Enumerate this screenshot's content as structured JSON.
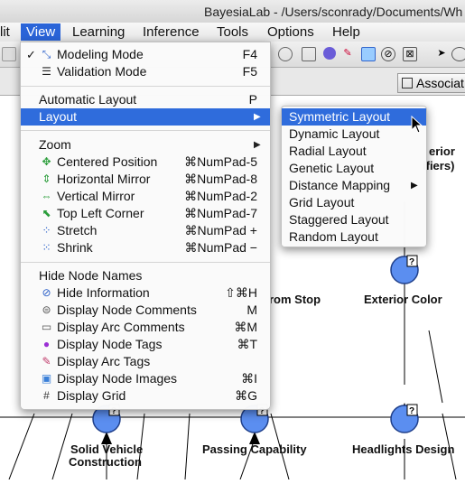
{
  "app": {
    "title": "BayesiaLab - /Users/sconrady/Documents/Wh"
  },
  "menubar": {
    "items": [
      "lit",
      "View",
      "Learning",
      "Inference",
      "Tools",
      "Options",
      "Help"
    ]
  },
  "tabstrip": {
    "assoc_tab": "Associat"
  },
  "view_menu": {
    "modeling_mode": {
      "label": "Modeling Mode",
      "shortcut": "F4",
      "checked": true
    },
    "validation_mode": {
      "label": "Validation Mode",
      "shortcut": "F5"
    },
    "automatic_layout": {
      "label": "Automatic Layout",
      "shortcut": "P"
    },
    "layout": {
      "label": "Layout"
    },
    "zoom": {
      "label": "Zoom"
    },
    "centered_position": {
      "label": "Centered Position",
      "shortcut": "⌘NumPad-5"
    },
    "horizontal_mirror": {
      "label": "Horizontal Mirror",
      "shortcut": "⌘NumPad-8"
    },
    "vertical_mirror": {
      "label": "Vertical Mirror",
      "shortcut": "⌘NumPad-2"
    },
    "top_left_corner": {
      "label": "Top Left Corner",
      "shortcut": "⌘NumPad-7"
    },
    "stretch": {
      "label": "Stretch",
      "shortcut": "⌘NumPad +"
    },
    "shrink": {
      "label": "Shrink",
      "shortcut": "⌘NumPad −"
    },
    "hide_node_names": {
      "label": "Hide Node Names"
    },
    "hide_information": {
      "label": "Hide Information",
      "shortcut": "⇧⌘H"
    },
    "display_node_comments": {
      "label": "Display Node Comments",
      "shortcut": "M"
    },
    "display_arc_comments": {
      "label": "Display Arc Comments",
      "shortcut": "⌘M"
    },
    "display_node_tags": {
      "label": "Display Node Tags",
      "shortcut": "⌘T"
    },
    "display_arc_tags": {
      "label": "Display Arc Tags"
    },
    "display_node_images": {
      "label": "Display Node Images",
      "shortcut": "⌘I"
    },
    "display_grid": {
      "label": "Display Grid",
      "shortcut": "⌘G"
    }
  },
  "layout_submenu": {
    "symmetric": "Symmetric Layout",
    "dynamic": "Dynamic Layout",
    "radial": "Radial Layout",
    "genetic": "Genetic Layout",
    "distance_mapping": "Distance Mapping",
    "grid": "Grid Layout",
    "staggered": "Staggered Layout",
    "random": "Random Layout"
  },
  "nodes": {
    "exterior_color": "Exterior Color",
    "rom_stop": "rom Stop",
    "erior": "erior",
    "fiers": "ifiers)",
    "solid_vehicle": "Solid Vehicle",
    "construction": "Construction",
    "passing": "Passing Capability",
    "headlights": "Headlights Design",
    "badge": "?"
  },
  "colors": {
    "accent": "#2f6cdc",
    "node": "#5b8ef0",
    "node_border": "#1f3f8a"
  }
}
